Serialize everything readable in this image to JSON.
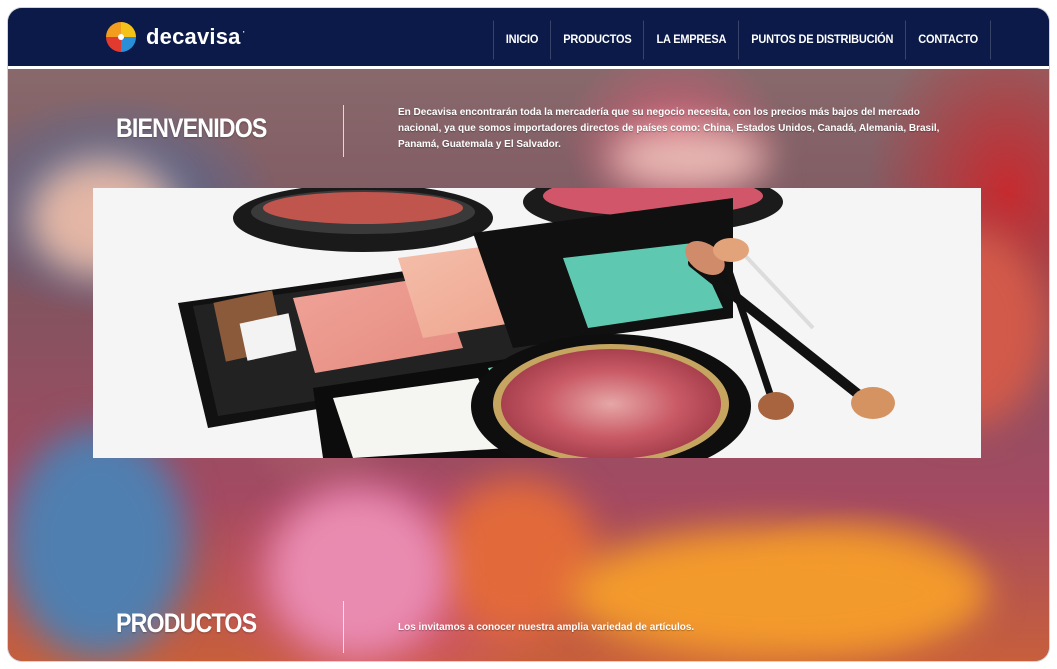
{
  "brand": {
    "name": "decavisa",
    "mark": "·"
  },
  "nav": {
    "items": [
      {
        "label": "INICIO"
      },
      {
        "label": "PRODUCTOS"
      },
      {
        "label": "LA EMPRESA"
      },
      {
        "label": "PUNTOS DE DISTRIBUCIÓN"
      },
      {
        "label": "CONTACTO"
      }
    ]
  },
  "welcome": {
    "title": "BIENVENIDOS",
    "text": "En Decavisa encontrarán toda la mercadería que su negocio necesita, con los precios más bajos del mercado nacional, ya que somos importadores directos de países como: China, Estados Unidos, Canadá, Alemania, Brasil, Panamá, Guatemala y El Salvador."
  },
  "slider": {
    "prev_icon": "chevron-left-icon",
    "next_icon": "chevron-right-icon",
    "prev_glyph": "◂",
    "next_glyph": "▸"
  },
  "products": {
    "title": "PRODUCTOS",
    "text": "Los invitamos a conocer nuestra amplia variedad de artículos."
  },
  "colors": {
    "navbar": "#0b1a48",
    "logo_yellow": "#f5c21a",
    "logo_red": "#e23a2e",
    "logo_blue": "#2a8fd8"
  }
}
